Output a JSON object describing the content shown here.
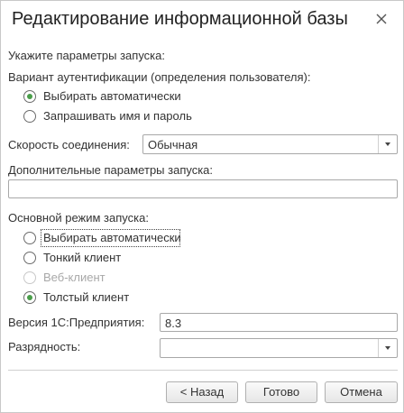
{
  "dialog": {
    "title": "Редактирование информационной базы"
  },
  "section_label": "Укажите параметры запуска:",
  "auth": {
    "label": "Вариант аутентификации (определения пользователя):",
    "options": [
      {
        "label": "Выбирать автоматически",
        "checked": true
      },
      {
        "label": "Запрашивать имя и пароль",
        "checked": false
      }
    ]
  },
  "speed": {
    "label": "Скорость соединения:",
    "value": "Обычная"
  },
  "extra_params": {
    "label": "Дополнительные параметры запуска:",
    "value": ""
  },
  "launch_mode": {
    "label": "Основной режим запуска:",
    "options": [
      {
        "label": "Выбирать автоматически",
        "checked": false,
        "disabled": false
      },
      {
        "label": "Тонкий клиент",
        "checked": false,
        "disabled": false
      },
      {
        "label": "Веб-клиент",
        "checked": false,
        "disabled": true
      },
      {
        "label": "Толстый клиент",
        "checked": true,
        "disabled": false
      }
    ]
  },
  "version": {
    "label": "Версия 1С:Предприятия:",
    "value": "8.3"
  },
  "bitness": {
    "label": "Разрядность:",
    "value": ""
  },
  "buttons": {
    "back": "< Назад",
    "done": "Готово",
    "cancel": "Отмена"
  }
}
